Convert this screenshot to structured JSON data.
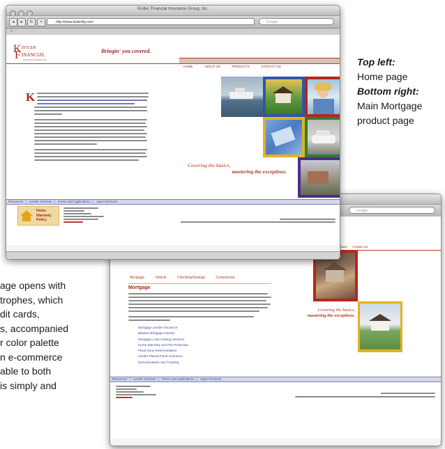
{
  "captions": {
    "top_left_heading": "Top left:",
    "top_left_text": "Home page",
    "bottom_right_heading": "Bottom right:",
    "bottom_right_line1": "Main Mortgage",
    "bottom_right_line2": "product page"
  },
  "body_text_lines": [
    "age opens with",
    "trophes, which",
    "dit cards,",
    "s, accompanied",
    "r color palette",
    "n e-commerce",
    "able to both",
    "is simply and"
  ],
  "home_window": {
    "title": "Kistler Financial Insurance Group, Inc.",
    "url": "http://www.kistlerfig.com",
    "search_placeholder": "Google",
    "logo_line1": "ISTLER",
    "logo_line2": "INANCIAL",
    "logo_line3": "INSURANCE GROUP, INC.",
    "tagline": "Bringin' you covered.",
    "nav": [
      "HOME",
      "ABOUT US",
      "PRODUCTS",
      "CONTACT US"
    ],
    "slogan_line1": "Covering the basics,",
    "slogan_line2": "mastering the exceptions.",
    "footer_links": [
      "Resources",
      "Lender Services",
      "Forms and Applications",
      "Agent Services"
    ],
    "badge_line1": "Home",
    "badge_line2": "Warranty",
    "badge_line3": "Policy"
  },
  "product_window": {
    "search_placeholder": "Google",
    "nav": [
      "Mortgage",
      "Vehicle",
      "Checking/Savings",
      "Commercial"
    ],
    "partial_nav": [
      "Products",
      "Contact Us"
    ],
    "heading": "Mortgage",
    "links": [
      "Mortgage Lender Insurance",
      "Blanket Mortgage Hazard",
      "Mortgage Loan Closing Services",
      "Home Warranty and Fire Protection",
      "Flood Zone Determinations",
      "Lender Placed Flood Insurance",
      "Documentation and Tracking"
    ],
    "slogan_line1": "Covering the basics,",
    "slogan_line2": "mastering the exceptions.",
    "footer_links": [
      "Resources",
      "Lender Services",
      "Forms and Applications",
      "Agent Services"
    ]
  },
  "colors": {
    "brand_red": "#a3281f",
    "nav_tan": "#d9c2b3",
    "footer_blue": "#d5d7ea",
    "tile_red": "#b5261e",
    "tile_yellow": "#e3b21c",
    "tile_green": "#2f7a3a",
    "tile_purple": "#4b2d83",
    "tile_blue": "#2f56a6"
  }
}
